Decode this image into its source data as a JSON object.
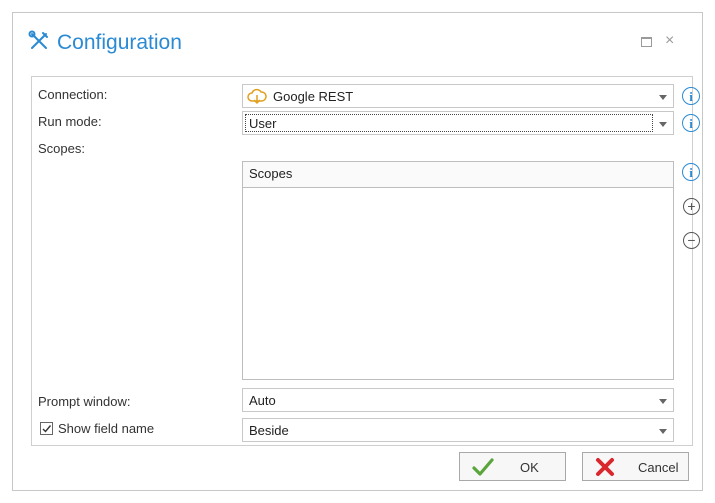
{
  "window": {
    "title": "Configuration",
    "title_icon": "tools-icon",
    "accent_color": "#2a8ad3"
  },
  "form": {
    "connection": {
      "label": "Connection:",
      "value": "Google REST",
      "icon": "cloud-icon"
    },
    "run_mode": {
      "label": "Run mode:",
      "value": "User"
    },
    "scopes": {
      "label": "Scopes:",
      "column_header": "Scopes",
      "items": []
    },
    "prompt_window": {
      "label": "Prompt window:",
      "value": "Auto"
    },
    "show_field_name": {
      "label": "Show field name",
      "checked": true,
      "value": "Beside"
    }
  },
  "buttons": {
    "ok_label": "OK",
    "cancel_label": "Cancel"
  }
}
